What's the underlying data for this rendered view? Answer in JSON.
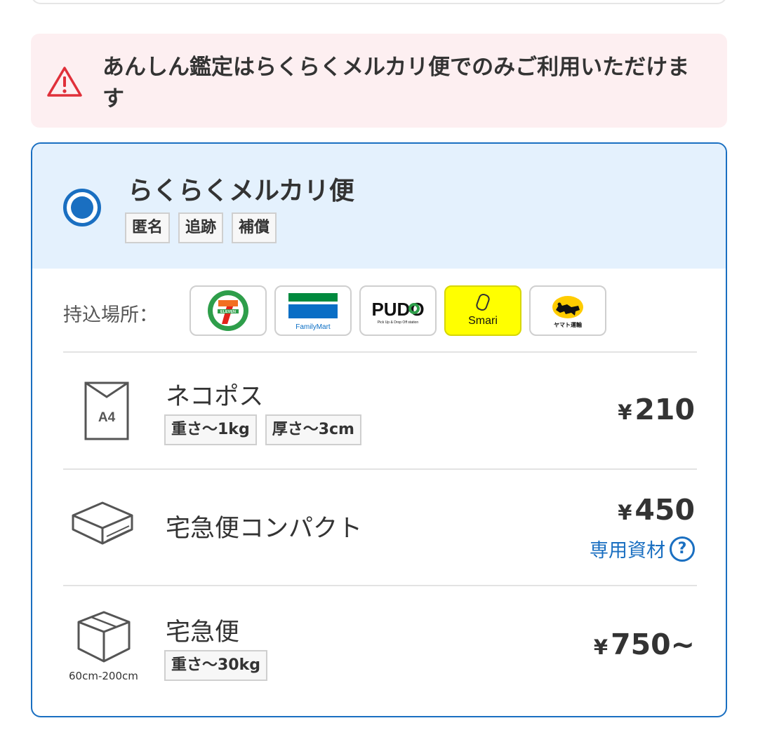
{
  "alert": {
    "message": "あんしん鑑定はらくらくメルカリ便でのみご利用いただけます",
    "icon": "warning-triangle-icon",
    "color": "#e0303a"
  },
  "service": {
    "title": "らくらくメルカリ便",
    "selected": true,
    "features": [
      "匿名",
      "追跡",
      "補償"
    ],
    "accent": "#1a6fc1"
  },
  "dropoff": {
    "label": "持込場所：",
    "locations": [
      {
        "name": "7-Eleven",
        "logo_text": "ELEVEN",
        "icon": "seven-eleven-logo"
      },
      {
        "name": "FamilyMart",
        "logo_text": "FamilyMart",
        "icon": "familymart-logo"
      },
      {
        "name": "PUDO",
        "logo_text": "PUDO",
        "sub_text": "Pick Up & Drop Off station",
        "icon": "pudo-logo"
      },
      {
        "name": "Smari",
        "logo_text": "Smari",
        "icon": "smari-logo"
      },
      {
        "name": "ヤマト運輸",
        "logo_text": "ヤマト運輸",
        "icon": "yamato-logo"
      }
    ]
  },
  "options": [
    {
      "name": "ネコポス",
      "icon": "a4-envelope-icon",
      "icon_text": "A4",
      "tags": [
        "重さ〜1kg",
        "厚さ〜3cm"
      ],
      "currency": "¥",
      "price": "210"
    },
    {
      "name": "宅急便コンパクト",
      "icon": "flat-box-icon",
      "tags": [],
      "currency": "¥",
      "price": "450",
      "link": "専用資材",
      "link_icon": "help-icon"
    },
    {
      "name": "宅急便",
      "icon": "box-icon",
      "icon_caption": "60cm-200cm",
      "tags": [
        "重さ〜30kg"
      ],
      "currency": "¥",
      "price": "750~"
    }
  ]
}
